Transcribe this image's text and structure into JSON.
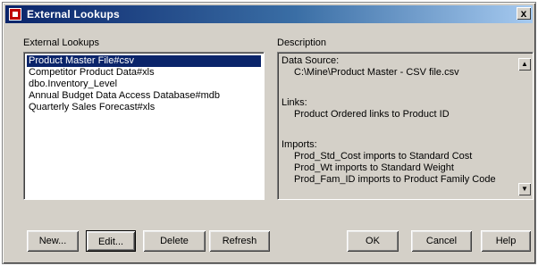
{
  "window": {
    "title": "External Lookups",
    "close_label": "x"
  },
  "lookups": {
    "label": "External Lookups",
    "items": [
      "Product Master File#csv",
      "Competitor Product Data#xls",
      "dbo.Inventory_Level",
      "Annual Budget Data Access Database#mdb",
      "Quarterly Sales Forecast#xls"
    ],
    "selected_index": 0
  },
  "description": {
    "label": "Description",
    "lines": [
      "Data Source:",
      "C:\\Mine\\Product Master - CSV file.csv",
      "",
      "Links:",
      "Product Ordered links to Product ID",
      "",
      "Imports:",
      "Prod_Std_Cost imports to Standard Cost",
      "Prod_Wt imports to Standard Weight",
      "Prod_Fam_ID imports to Product Family Code"
    ]
  },
  "buttons": {
    "new": "New...",
    "edit": "Edit...",
    "delete": "Delete",
    "refresh": "Refresh",
    "ok": "OK",
    "cancel": "Cancel",
    "help": "Help"
  },
  "icons": {
    "title": "dialog-icon",
    "scroll_up": "scroll-up-icon",
    "scroll_down": "scroll-down-icon"
  }
}
